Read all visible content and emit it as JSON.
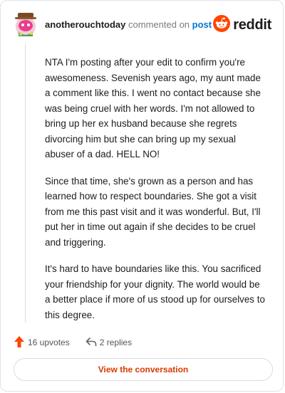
{
  "header": {
    "username": "anotherouchtoday",
    "commented_text": "commented on",
    "post_link": "post",
    "brand": "reddit",
    "avatar_icon": "snoo-avatar-icon",
    "brand_icon": "reddit-logo-icon"
  },
  "comment": {
    "paragraphs": [
      "NTA I'm posting after your edit to confirm you're awesomeness. Sevenish years ago, my aunt made a comment like this. I went no contact because she was being cruel with her words. I'm not allowed to bring up her ex husband because she regrets divorcing him but she can bring up my sexual abuser of a dad. HELL NO!",
      "Since that time, she's grown as a person and has learned how to respect boundaries. She got a visit from me this past visit and it was wonderful. But, I'll put her in time out again if she decides to be cruel and triggering.",
      "It's hard to have boundaries like this. You sacrificed your friendship for your dignity. The world would be a better place if more of us stood up for ourselves to this degree."
    ]
  },
  "actions": {
    "upvotes": "16 upvotes",
    "replies": "2 replies",
    "upvote_icon": "upvote-arrow-icon",
    "reply_icon": "reply-arrow-icon"
  },
  "footer": {
    "view_button": "View the conversation"
  },
  "colors": {
    "accent": "#d93a00",
    "link": "#0079d3",
    "reddit_orange": "#ff4500"
  }
}
